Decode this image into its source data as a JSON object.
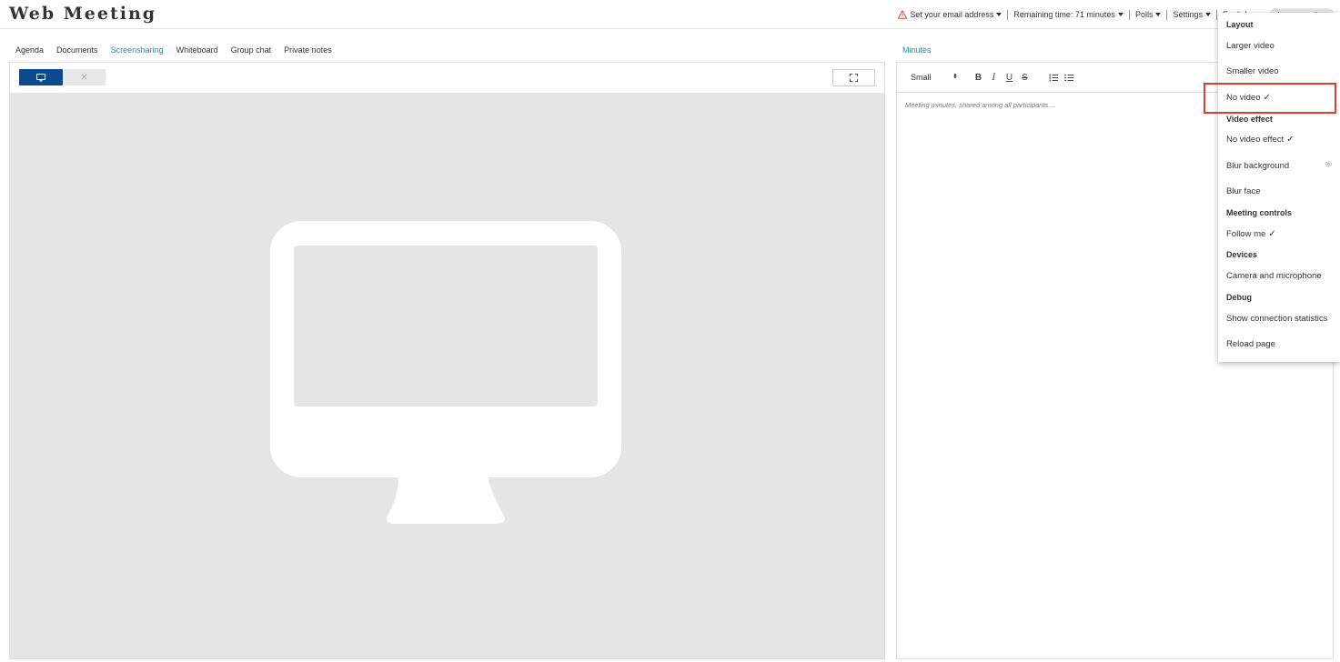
{
  "app": {
    "title": "Web Meeting"
  },
  "topnav": {
    "email": "Set your email address",
    "remaining": "Remaining time: 71 minutes",
    "polls": "Polls",
    "settings": "Settings",
    "language": "English",
    "leave": "Leave meeting"
  },
  "tabs_left": [
    "Agenda",
    "Documents",
    "Screensharing",
    "Whiteboard",
    "Group chat",
    "Private notes"
  ],
  "tabs_left_active": "Screensharing",
  "tabs_right": [
    "Minutes"
  ],
  "editor": {
    "size": "Small",
    "placeholder": "Meeting minutes, shared among all participants ..."
  },
  "menu": {
    "layout_header": "Layout",
    "larger_video": "Larger video",
    "smaller_video": "Smaller video",
    "no_video": "No video",
    "video_effect_header": "Video effect",
    "no_video_effect": "No video effect",
    "blur_background": "Blur background",
    "blur_face": "Blur face",
    "meeting_controls_header": "Meeting controls",
    "follow_me": "Follow me",
    "devices_header": "Devices",
    "camera_mic": "Camera and microphone",
    "debug_header": "Debug",
    "show_stats": "Show connection statistics",
    "reload": "Reload page",
    "checkmark": "✓"
  },
  "colors": {
    "accent": "#1a8fb6",
    "screen_button": "#0b4a8c",
    "highlight": "#e53a2a",
    "share_bg": "#e5e5e5"
  }
}
